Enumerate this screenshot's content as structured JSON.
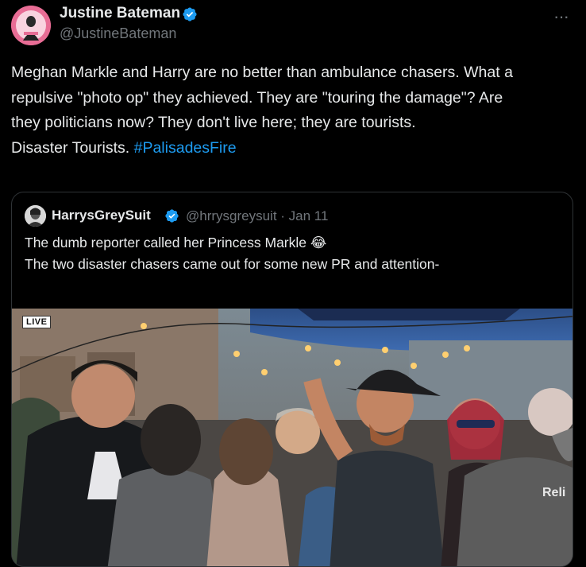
{
  "author": {
    "name": "Justine Bateman",
    "handle": "@JustineBateman"
  },
  "menu": {
    "more_label": "···"
  },
  "body": {
    "line1": "Meghan Markle and Harry are no better than ambulance chasers. What a",
    "line2": "repulsive \"photo op\" they achieved. They are \"touring the damage\"? Are",
    "line3": "they politicians now? They don't live here; they are tourists.",
    "line4_text": "Disaster Tourists. ",
    "hashtag": "#PalisadesFire"
  },
  "quoted": {
    "name": "HarrysGreySuit",
    "meta": "@hrrysgreysuit · Jan 11",
    "line1": "The dumb reporter called her Princess Markle 😂",
    "line2": "The two disaster chasers came out for some new PR and attention-",
    "video": {
      "live_label": "LIVE",
      "sign_text": "Reli"
    }
  },
  "colors": {
    "background": "#000000",
    "text": "#e7e9ea",
    "secondary": "#71767b",
    "link": "#1d9bf0",
    "verified": "#1d9bf0",
    "border": "#2f3336"
  }
}
